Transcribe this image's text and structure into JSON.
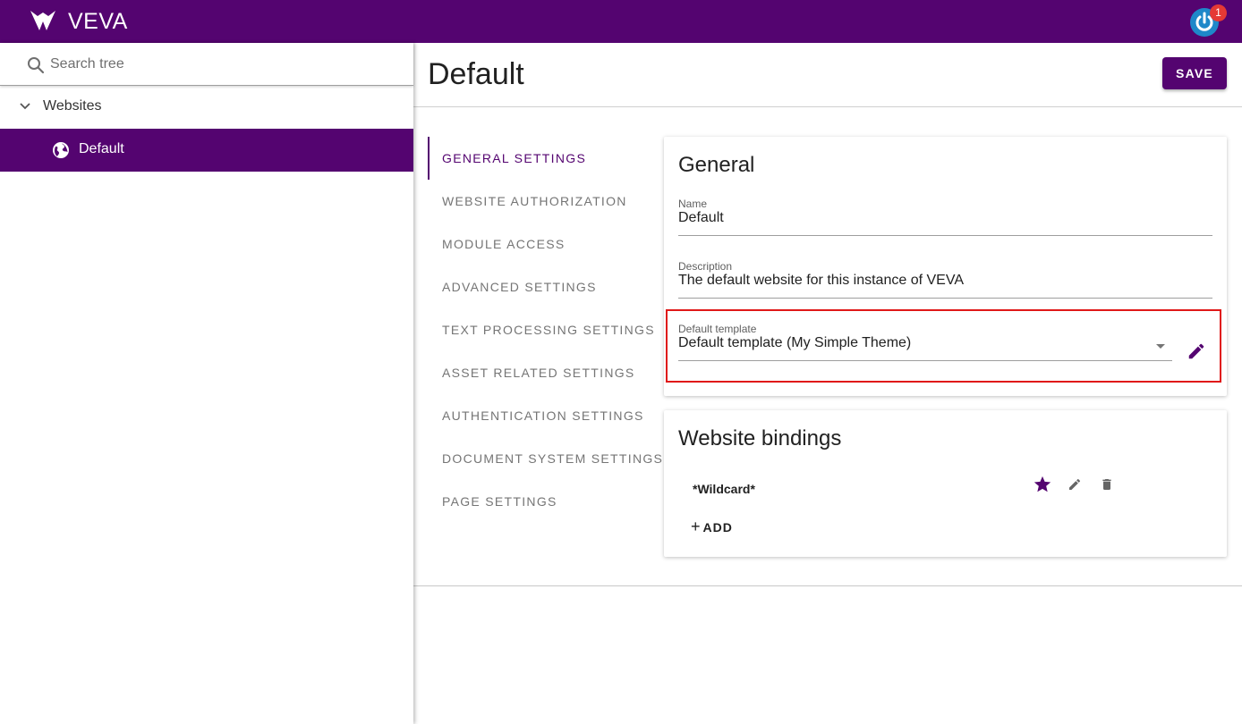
{
  "app": {
    "name": "VEVA",
    "notification_count": "1"
  },
  "sidebar": {
    "search_placeholder": "Search tree",
    "tree": {
      "root_label": "Websites",
      "selected_label": "Default"
    }
  },
  "main": {
    "page_title": "Default",
    "save_label": "SAVE",
    "tabs": [
      {
        "label": "GENERAL SETTINGS",
        "active": true
      },
      {
        "label": "WEBSITE AUTHORIZATION"
      },
      {
        "label": "MODULE ACCESS"
      },
      {
        "label": "ADVANCED SETTINGS"
      },
      {
        "label": "TEXT PROCESSING SETTINGS"
      },
      {
        "label": "ASSET RELATED SETTINGS"
      },
      {
        "label": "AUTHENTICATION SETTINGS"
      },
      {
        "label": "DOCUMENT SYSTEM SETTINGS"
      },
      {
        "label": "PAGE SETTINGS"
      }
    ],
    "general": {
      "title": "General",
      "name_label": "Name",
      "name_value": "Default",
      "description_label": "Description",
      "description_value": "The default website for this instance of VEVA",
      "template_label": "Default template",
      "template_value": "Default template (My Simple Theme)"
    },
    "bindings": {
      "title": "Website bindings",
      "items": [
        {
          "name": "*Wildcard*"
        }
      ],
      "add_label": "ADD"
    }
  },
  "colors": {
    "brand": "#540470",
    "highlight": "#e01818",
    "badge": "#e53935",
    "power": "#1e88c9"
  },
  "icons": [
    "veva-logo-icon",
    "power-icon",
    "search-icon",
    "chevron-down-icon",
    "globe-icon",
    "pencil-icon",
    "star-icon",
    "trash-icon",
    "plus-icon"
  ]
}
